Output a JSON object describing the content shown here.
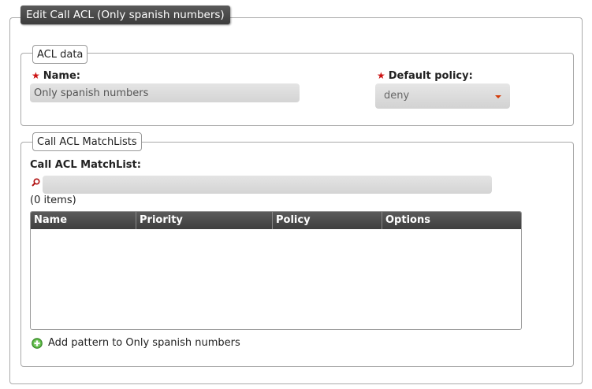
{
  "panel": {
    "title": "Edit Call ACL (Only spanish numbers)"
  },
  "acl_data": {
    "legend": "ACL data",
    "name_label": "Name:",
    "name_value": "Only spanish numbers",
    "policy_label": "Default policy:",
    "policy_value": "deny"
  },
  "matchlists": {
    "legend": "Call ACL MatchLists",
    "label": "Call ACL MatchList:",
    "search_value": "",
    "count": "(0 items)",
    "columns": [
      "Name",
      "Priority",
      "Policy",
      "Options"
    ],
    "rows": [],
    "add_link": "Add pattern to Only spanish numbers"
  },
  "colors": {
    "required_star": "#cc1111",
    "header_bg": "#4a4a4a",
    "caret": "#d43c0a",
    "add_icon": "#3c9a2c"
  },
  "icons": {
    "required": "star-icon",
    "search": "search-icon",
    "add": "add-circle-icon",
    "dropdown": "caret-down-icon"
  }
}
